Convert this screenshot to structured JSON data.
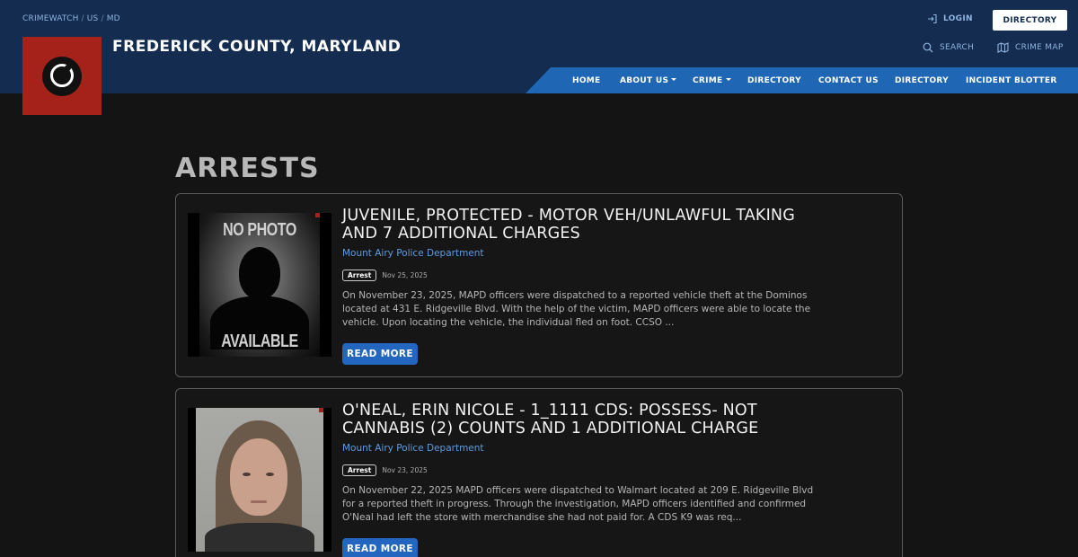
{
  "header": {
    "breadcrumbs": [
      "CRIMEWATCH",
      "US",
      "MD"
    ],
    "breadcrumb_separator": "/",
    "site_title": "FREDERICK COUNTY, MARYLAND",
    "login_label": "LOGIN",
    "directory_button": "DIRECTORY",
    "search_label": "SEARCH",
    "crime_map_label": "CRIME MAP",
    "brand_color": "#132c4f",
    "logo_color": "#a5221b"
  },
  "nav": {
    "color": "#1f67b4",
    "items": [
      {
        "label": "HOME",
        "dropdown": false
      },
      {
        "label": "ABOUT US",
        "dropdown": true
      },
      {
        "label": "CRIME",
        "dropdown": true
      },
      {
        "label": "DIRECTORY",
        "dropdown": false
      },
      {
        "label": "CONTACT US",
        "dropdown": false
      },
      {
        "label": "DIRECTORY",
        "dropdown": false
      },
      {
        "label": "INCIDENT BLOTTER",
        "dropdown": false
      }
    ]
  },
  "page": {
    "heading": "ARRESTS"
  },
  "arrests": [
    {
      "title": "JUVENILE, PROTECTED - MOTOR VEH/UNLAWFUL TAKING AND 7 ADDITIONAL CHARGES",
      "agency": "Mount Airy Police Department",
      "badge": "Arrest",
      "date": "Nov 25, 2025",
      "excerpt": "On November 23, 2025, MAPD officers were dispatched to a reported vehicle theft at the Dominos located at 431 E. Ridgeville Blvd. With the help of the victim, MAPD officers were able to locate the vehicle. Upon locating the vehicle, the individual fled on foot. CCSO ...",
      "photo_top_text": "NO PHOTO",
      "photo_bottom_text": "AVAILABLE",
      "read_more": "READ MORE"
    },
    {
      "title": "O'NEAL, ERIN NICOLE - 1_1111 CDS: POSSESS- NOT CANNABIS (2) COUNTS AND 1 ADDITIONAL CHARGE",
      "agency": "Mount Airy Police Department",
      "badge": "Arrest",
      "date": "Nov 23, 2025",
      "excerpt": "On November 22, 2025 MAPD officers were dispatched to Walmart located at 209 E. Ridgeville Blvd for a reported theft in progress. Through the investigation, MAPD officers identified and confirmed O'Neal had left the store with merchandise she had not paid for. A CDS K9 was req...",
      "read_more": "READ MORE"
    }
  ]
}
